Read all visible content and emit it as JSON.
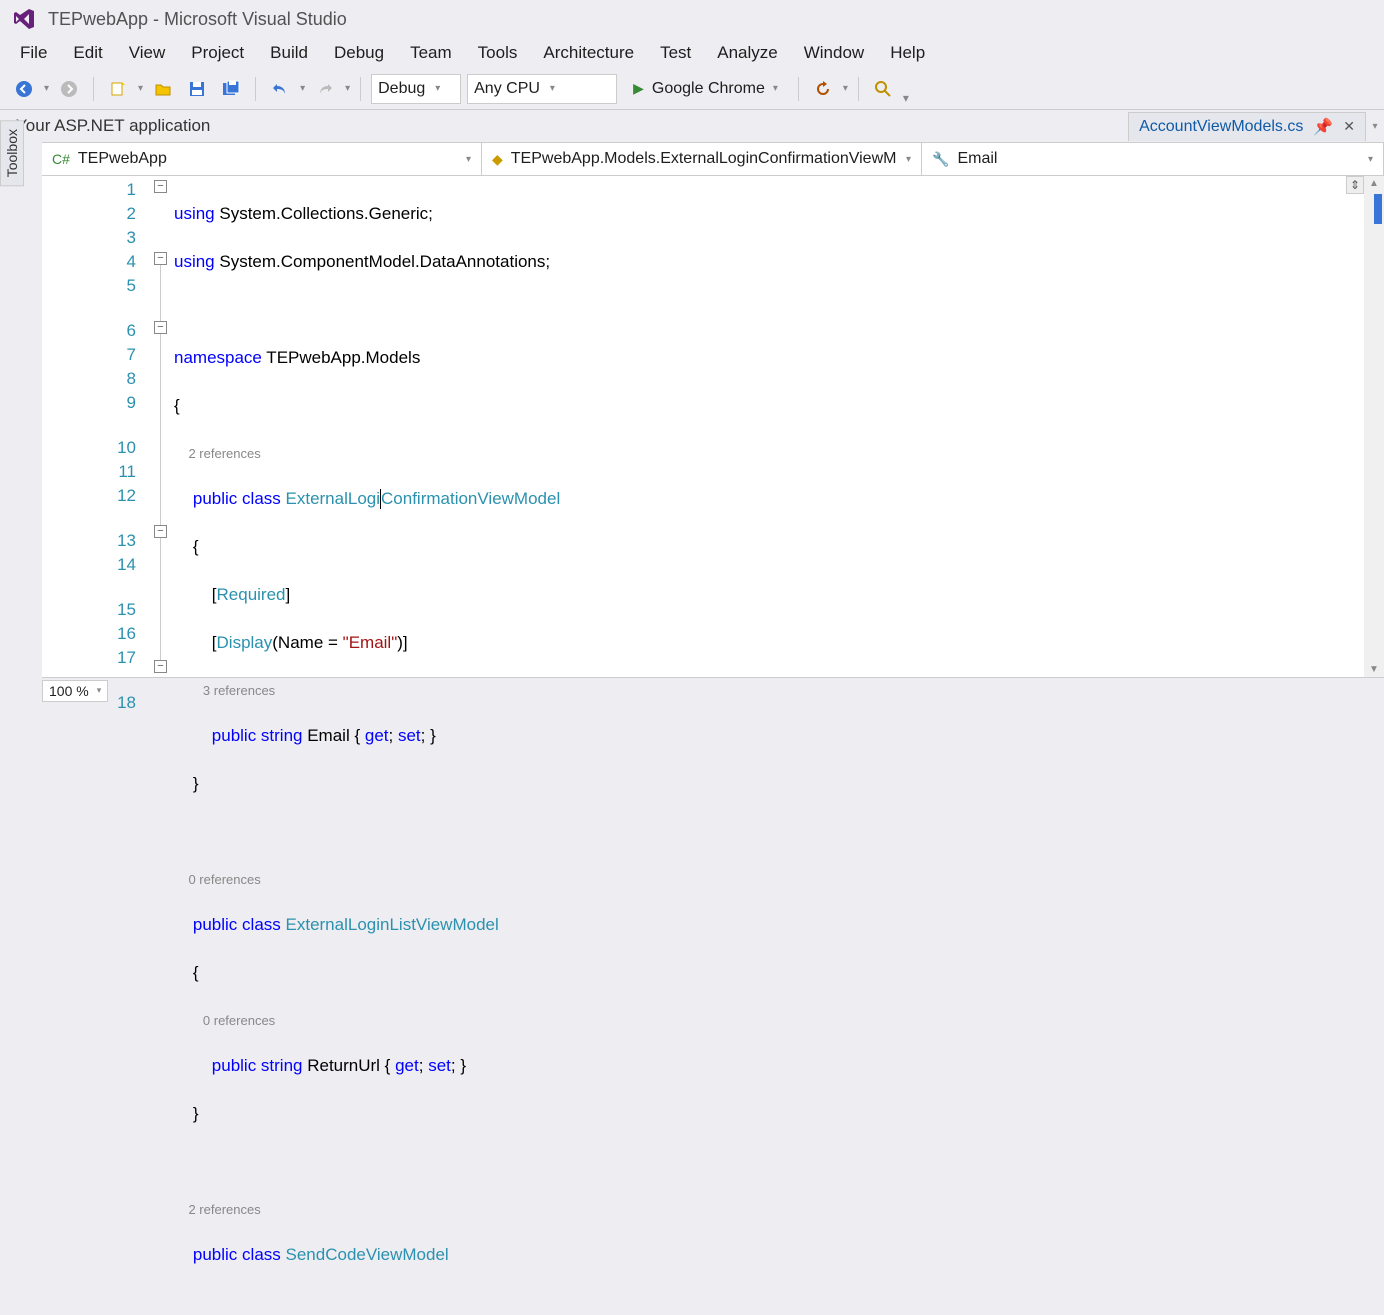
{
  "window": {
    "title": "TEPwebApp - Microsoft Visual Studio"
  },
  "menu": {
    "items": [
      "File",
      "Edit",
      "View",
      "Project",
      "Build",
      "Debug",
      "Team",
      "Tools",
      "Architecture",
      "Test",
      "Analyze",
      "Window",
      "Help"
    ]
  },
  "toolbar": {
    "config": "Debug",
    "platform": "Any CPU",
    "start_target": "Google Chrome"
  },
  "app_header": "Your ASP.NET application",
  "doc_tab": "AccountViewModels.cs",
  "side_tab": "Toolbox",
  "nav": {
    "project": "TEPwebApp",
    "scope": "TEPwebApp.Models.ExternalLoginConfirmationViewM",
    "member": "Email"
  },
  "zoom": "100 %",
  "code": {
    "lines": {
      "l1a": "using",
      "l1b": " System.Collections.Generic;",
      "l2a": "using",
      "l2b": " System.ComponentModel.DataAnnotations;",
      "l4a": "namespace",
      "l4b": " TEPwebApp.Models",
      "l5": "{",
      "ref6": "2 references",
      "l6a": "    public",
      "l6b": " class",
      "l6c": " ExternalLogi",
      "l6d": "ConfirmationViewModel",
      "l7": "    {",
      "l8a": "        [",
      "l8b": "Required",
      "l8c": "]",
      "l9a": "        [",
      "l9b": "Display",
      "l9c": "(Name = ",
      "l9d": "\"Email\"",
      "l9e": ")]",
      "ref10": "3 references",
      "l10a": "        public",
      "l10b": " string",
      "l10c": " Email { ",
      "l10d": "get",
      "l10e": "; ",
      "l10f": "set",
      "l10g": "; }",
      "l11": "    }",
      "ref13": "0 references",
      "l13a": "    public",
      "l13b": " class",
      "l13c": " ExternalLoginListViewModel",
      "l14": "    {",
      "ref15": "0 references",
      "l15a": "        public",
      "l15b": " string",
      "l15c": " ReturnUrl { ",
      "l15d": "get",
      "l15e": "; ",
      "l15f": "set",
      "l15g": "; }",
      "l16": "    }",
      "ref18": "2 references",
      "l18a": "    public",
      "l18b": " class",
      "l18c": " SendCodeViewModel"
    },
    "line_numbers": [
      "1",
      "2",
      "3",
      "4",
      "5",
      "",
      "6",
      "7",
      "8",
      "9",
      "",
      "10",
      "11",
      "12",
      "",
      "13",
      "14",
      "",
      "15",
      "16",
      "17",
      "",
      "18"
    ]
  }
}
